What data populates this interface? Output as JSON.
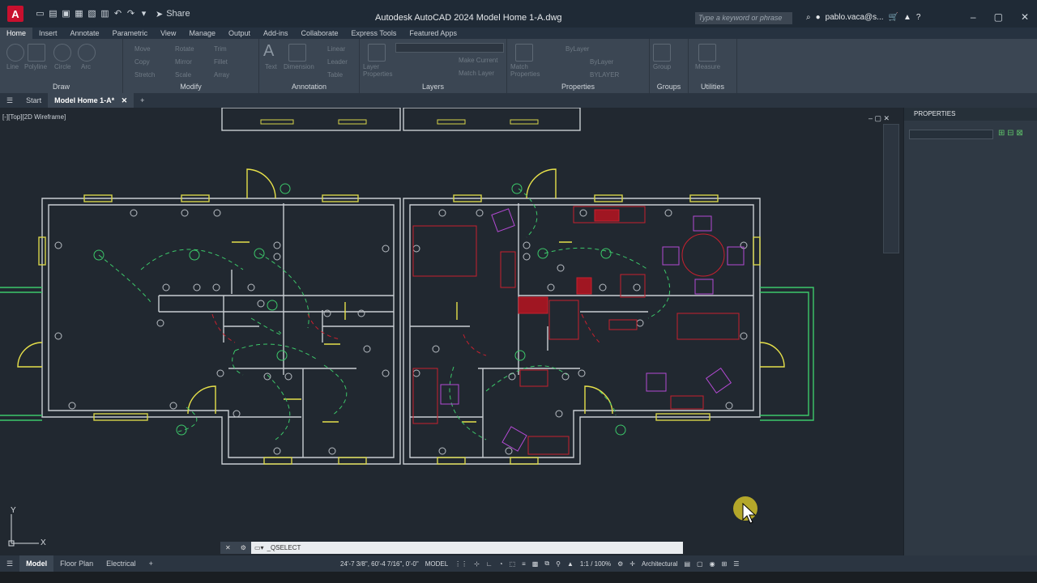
{
  "app": {
    "logo": "A",
    "title": "Autodesk AutoCAD 2024   Model Home 1-A.dwg",
    "share_label": "Share",
    "search_placeholder": "Type a keyword or phrase",
    "user": "pablo.vaca@s..."
  },
  "ribbon_tabs": [
    {
      "label": "Home",
      "active": true
    },
    {
      "label": "Insert"
    },
    {
      "label": "Annotate"
    },
    {
      "label": "Parametric"
    },
    {
      "label": "View"
    },
    {
      "label": "Manage"
    },
    {
      "label": "Output"
    },
    {
      "label": "Add-ins"
    },
    {
      "label": "Collaborate"
    },
    {
      "label": "Express Tools"
    },
    {
      "label": "Featured Apps"
    }
  ],
  "ribbon_panels": {
    "draw": {
      "title": "Draw",
      "tools": [
        "Line",
        "Polyline",
        "Circle",
        "Arc"
      ]
    },
    "modify": {
      "title": "Modify",
      "tools": [
        "Move",
        "Rotate",
        "Trim",
        "Copy",
        "Mirror",
        "Fillet",
        "Stretch",
        "Scale",
        "Array"
      ]
    },
    "annotation": {
      "title": "Annotation",
      "tools": [
        "Text",
        "Dimension",
        "Linear",
        "Leader",
        "Table"
      ]
    },
    "layers": {
      "title": "Layers",
      "tools": [
        "Layer Properties",
        "Make Current",
        "Match Layer"
      ]
    },
    "properties": {
      "title": "Properties",
      "tools": [
        "Match Properties",
        "ByLayer",
        "ByLayer",
        "BYLAYER"
      ]
    },
    "groups": {
      "title": "Groups",
      "tools": [
        "Group"
      ]
    },
    "utilities": {
      "title": "Utilities",
      "tools": [
        "Measure"
      ]
    }
  },
  "doc_tabs": [
    {
      "label": "Start"
    },
    {
      "label": "Model Home 1-A*",
      "active": true
    }
  ],
  "viewport_label": "[-][Top][2D Wireframe]",
  "properties_panel": {
    "title": "PROPERTIES"
  },
  "command_line": {
    "text": "_QSELECT"
  },
  "layout_tabs": [
    {
      "label": "Model",
      "active": true
    },
    {
      "label": "Floor Plan"
    },
    {
      "label": "Electrical"
    }
  ],
  "status": {
    "coordinates": "24'-7 3/8\", 60'-4 7/16\", 0'-0\"",
    "mode": "MODEL",
    "scale": "1:1 / 100%",
    "units": "Architectural"
  },
  "colors": {
    "wall": "#c9cdd2",
    "window": "#d6d44a",
    "door": "#e6e04a",
    "electrical": "#3cc86a",
    "furniture_red": "#c8202e",
    "furniture_magenta": "#b44ad4"
  }
}
